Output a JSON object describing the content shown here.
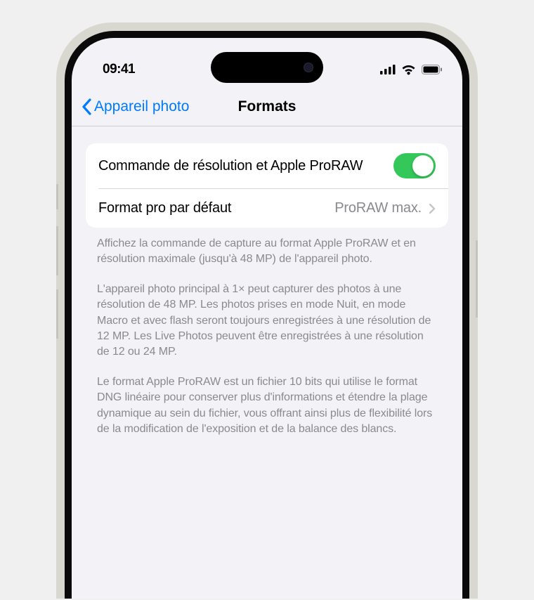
{
  "status_bar": {
    "time": "09:41"
  },
  "nav": {
    "back_label": "Appareil photo",
    "title": "Formats"
  },
  "settings": {
    "row1": {
      "label": "Commande de résolution et Apple ProRAW",
      "toggle_on": true
    },
    "row2": {
      "label": "Format pro par défaut",
      "value": "ProRAW max."
    }
  },
  "footer": {
    "p1": "Affichez la commande de capture au format Apple ProRAW et en résolution maximale (jusqu'à 48 MP) de l'appareil photo.",
    "p2": "L'appareil photo principal à 1× peut capturer des photos à une résolution de 48 MP. Les photos prises en mode Nuit, en mode Macro et avec flash seront toujours enregistrées à une résolution de 12 MP. Les Live Photos peuvent être enregistrées à une résolution de 12 ou 24 MP.",
    "p3": "Le format Apple ProRAW est un fichier 10 bits qui utilise le format DNG linéaire pour conserver plus d'informations et étendre la plage dynamique au sein du fichier, vous offrant ainsi plus de flexibilité lors de la modification de l'exposition et de la balance des blancs."
  }
}
